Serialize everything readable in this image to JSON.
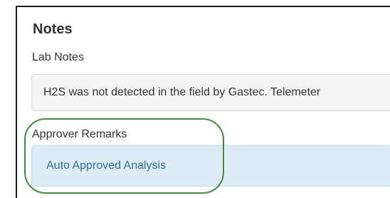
{
  "notes": {
    "title": "Notes",
    "lab_notes": {
      "label": "Lab Notes",
      "value": "H2S was not detected in the field by Gastec. Telemeter"
    },
    "approver_remarks": {
      "label": "Approver Remarks",
      "value": "Auto Approved Analysis"
    }
  },
  "colors": {
    "remark_background": "#dcebf6",
    "remark_text": "#31708f",
    "highlight_ring": "#3e8e3e",
    "lab_background": "#f5f5f5"
  }
}
